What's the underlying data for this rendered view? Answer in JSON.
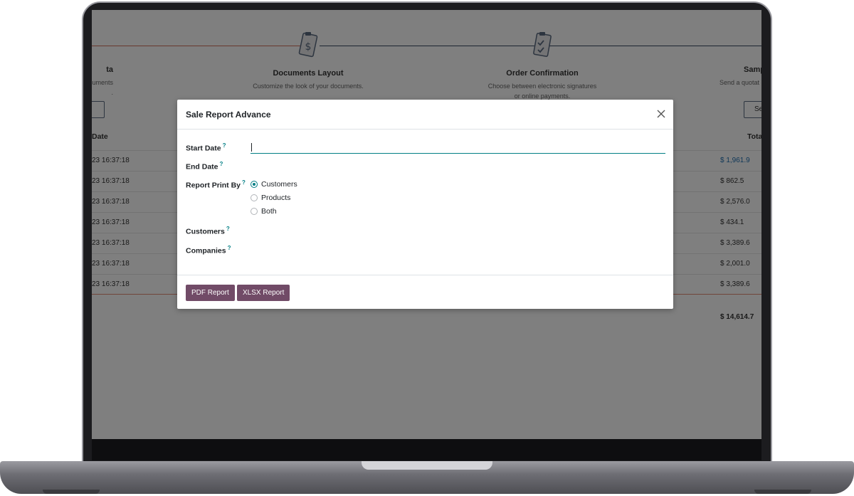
{
  "background": {
    "steps": [
      {
        "title": "ta",
        "desc1": "or documents",
        "desc2": "."
      },
      {
        "title": "Documents Layout",
        "desc1": "Customize the look of your documents.",
        "desc2": ""
      },
      {
        "title": "Order Confirmation",
        "desc1": "Choose between electronic signatures",
        "desc2": "or online payments."
      },
      {
        "title": "Samp",
        "desc1": "Send a quotat",
        "desc2": ""
      }
    ],
    "sample_button_label": "Se",
    "table": {
      "date_header": "Date",
      "total_header": "Tota",
      "rows": [
        {
          "date": "23 16:37:18",
          "total": "$ 1,961.9"
        },
        {
          "date": "23 16:37:18",
          "total": "$ 862.5"
        },
        {
          "date": "23 16:37:18",
          "total": "$ 2,576.0"
        },
        {
          "date": "23 16:37:18",
          "total": "$ 434.1"
        },
        {
          "date": "23 16:37:18",
          "total": "$ 3,389.6"
        },
        {
          "date": "23 16:37:18",
          "total": "$ 2,001.0"
        },
        {
          "date": "23 16:37:18",
          "total": "$ 3,389.6"
        }
      ],
      "sum": "$ 14,614.7"
    }
  },
  "dialog": {
    "title": "Sale Report Advance",
    "fields": {
      "start_date": "Start Date",
      "end_date": "End Date",
      "report_print_by": "Report Print By",
      "customers": "Customers",
      "companies": "Companies",
      "help_mark": "?"
    },
    "start_date_value": "",
    "radio_options": [
      {
        "label": "Customers",
        "checked": true
      },
      {
        "label": "Products",
        "checked": false
      },
      {
        "label": "Both",
        "checked": false
      }
    ],
    "buttons": {
      "pdf": "PDF Report",
      "xlsx": "XLSX Report"
    }
  },
  "colors": {
    "primary": "#714b67",
    "accent": "#017e84",
    "link": "#1f6fb0"
  }
}
